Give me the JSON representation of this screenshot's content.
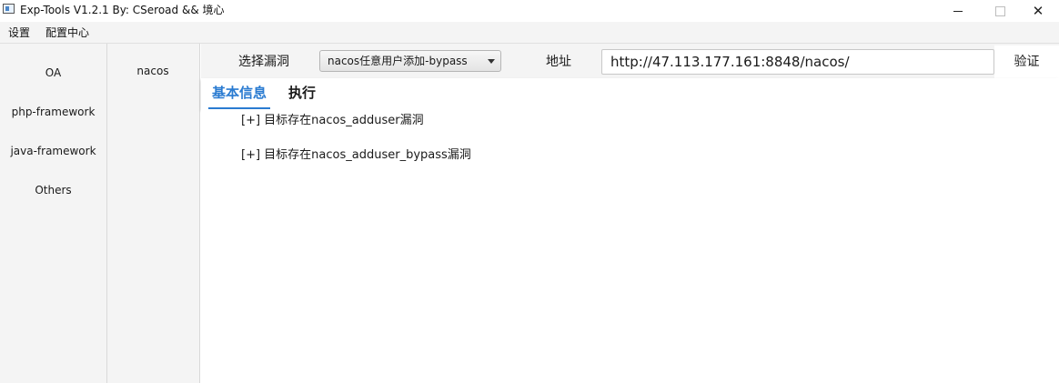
{
  "window": {
    "title": "Exp-Tools V1.2.1 By: CSeroad && 境心",
    "controls": {
      "minimize": "—",
      "maximize": "□",
      "close": "✕"
    }
  },
  "menu": {
    "items": [
      {
        "label": "设置"
      },
      {
        "label": "配置中心"
      }
    ]
  },
  "categories": [
    {
      "label": "OA"
    },
    {
      "label": "php-framework"
    },
    {
      "label": "java-framework"
    },
    {
      "label": "Others"
    }
  ],
  "subcategories": [
    {
      "label": "nacos"
    }
  ],
  "toolbar": {
    "vuln_label": "选择漏洞",
    "vuln_selected": "nacos任意用户添加-bypass",
    "address_label": "地址",
    "address_value": "http://47.113.177.161:8848/nacos/",
    "verify_label": "验证"
  },
  "tabs": [
    {
      "label": "基本信息",
      "active": true
    },
    {
      "label": "执行",
      "active": false
    }
  ],
  "output": {
    "lines": [
      "[+] 目标存在nacos_adduser漏洞",
      "[+] 目标存在nacos_adduser_bypass漏洞"
    ]
  },
  "colors": {
    "accent": "#2a7bd1",
    "panel_bg": "#f4f4f4",
    "content_bg": "#ffffff"
  },
  "icons": {
    "app": "app-window-icon",
    "select": "chevron-down-icon"
  }
}
